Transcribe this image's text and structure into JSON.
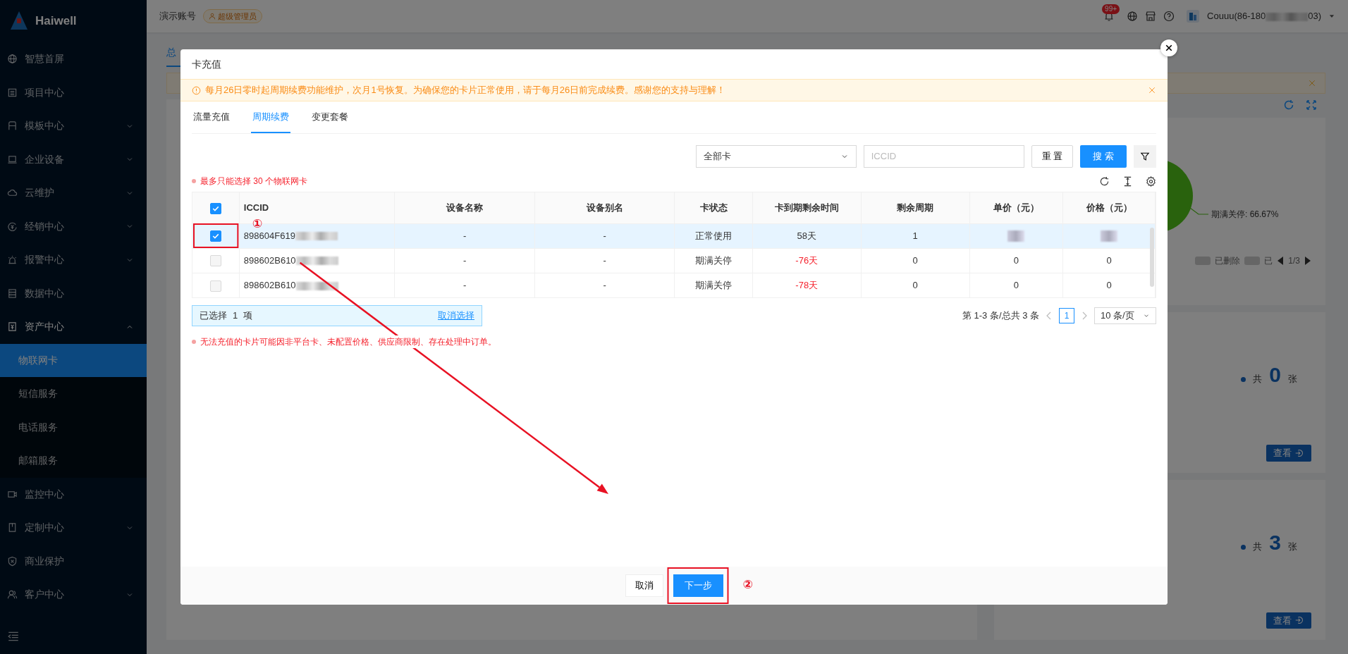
{
  "sidebar": {
    "logo": "Haiwell",
    "items": [
      {
        "label": "智慧首屏",
        "kind": "link"
      },
      {
        "label": "项目中心",
        "kind": "link"
      },
      {
        "label": "模板中心",
        "kind": "group",
        "expanded": false
      },
      {
        "label": "企业设备",
        "kind": "group",
        "expanded": false
      },
      {
        "label": "云维护",
        "kind": "group",
        "expanded": false
      },
      {
        "label": "经销中心",
        "kind": "group",
        "expanded": false
      },
      {
        "label": "报警中心",
        "kind": "group",
        "expanded": false
      },
      {
        "label": "数据中心",
        "kind": "link"
      },
      {
        "label": "资产中心",
        "kind": "group",
        "expanded": true,
        "children": [
          {
            "label": "物联网卡",
            "selected": true
          },
          {
            "label": "短信服务",
            "selected": false
          },
          {
            "label": "电话服务",
            "selected": false
          },
          {
            "label": "邮箱服务",
            "selected": false
          }
        ]
      },
      {
        "label": "监控中心",
        "kind": "link"
      },
      {
        "label": "定制中心",
        "kind": "group",
        "expanded": false
      },
      {
        "label": "商业保护",
        "kind": "link"
      },
      {
        "label": "客户中心",
        "kind": "group",
        "expanded": false
      }
    ]
  },
  "header": {
    "account": "演示账号",
    "role": "超级管理员",
    "notification_count": "99+",
    "user": "Couuu(86-180",
    "user_suffix": "03)"
  },
  "background": {
    "tab": "总",
    "pie_label": "期满关停: 66.67%",
    "legend": [
      "已删除",
      "已"
    ],
    "page": "1/3",
    "cards": [
      {
        "prefix": "共",
        "count": "0",
        "unit": "张",
        "button": "查看"
      },
      {
        "prefix": "共",
        "count": "3",
        "unit": "张",
        "button": "查看"
      }
    ]
  },
  "modal": {
    "title": "卡充值",
    "notice": "每月26日零时起周期续费功能维护，次月1号恢复。为确保您的卡片正常使用，请于每月26日前完成续费。感谢您的支持与理解！",
    "tabs": [
      {
        "label": "流量充值",
        "selected": false
      },
      {
        "label": "周期续费",
        "selected": true
      },
      {
        "label": "变更套餐",
        "selected": false
      }
    ],
    "filter": {
      "select": "全部卡",
      "placeholder": "ICCID",
      "reset": "重 置",
      "search": "搜 索"
    },
    "limit_note": "最多只能选择 30 个物联网卡",
    "table": {
      "header_checked": true,
      "columns": [
        "ICCID",
        "设备名称",
        "设备别名",
        "卡状态",
        "卡到期剩余时间",
        "剩余周期",
        "单价（元）",
        "价格（元）"
      ],
      "rows": [
        {
          "checked": true,
          "iccid": "898604F619",
          "device_name": "-",
          "alias": "-",
          "status": "正常使用",
          "remaining": "58天",
          "overdue": false,
          "cycles": "1"
        },
        {
          "checked": false,
          "iccid": "898602B610",
          "device_name": "-",
          "alias": "-",
          "status": "期满关停",
          "remaining": "-76天",
          "overdue": true,
          "cycles": "0",
          "unit_price": "0",
          "price": "0"
        },
        {
          "checked": false,
          "iccid": "898602B610",
          "device_name": "-",
          "alias": "-",
          "status": "期满关停",
          "remaining": "-78天",
          "overdue": true,
          "cycles": "0",
          "unit_price": "0",
          "price": "0"
        }
      ]
    },
    "selection": {
      "label": "已选择",
      "count": "1",
      "unit": "项",
      "clear": "取消选择"
    },
    "pagination": {
      "summary": "第 1-3 条/总共 3 条",
      "pages": [
        {
          "label": "1",
          "selected": true
        }
      ],
      "page_size": "10 条/页"
    },
    "warn_note": "无法充值的卡片可能因非平台卡、未配置价格、供应商限制、存在处理中订单。",
    "footer": {
      "cancel": "取消",
      "next": "下一步"
    }
  },
  "annotations": {
    "step_1": "①",
    "step_2": "②"
  }
}
